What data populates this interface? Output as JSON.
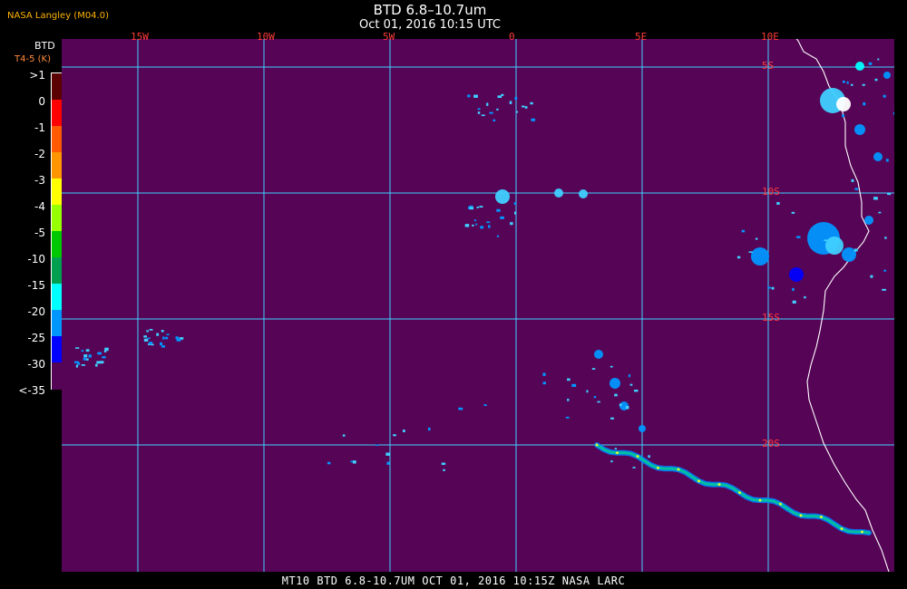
{
  "header": {
    "org": "NASA Langley (M04.0)",
    "title": "BTD 6.8–10.7um",
    "subtitle": "Oct 01, 2016 10:15 UTC"
  },
  "legend": {
    "title": "BTD",
    "subtitle": "T4-5 (K)",
    "labels": [
      ">1",
      "0",
      "-1",
      "-2",
      "-3",
      "-4",
      "-5",
      "-10",
      "-15",
      "-20",
      "-25",
      "-30",
      "<-35"
    ],
    "colors": [
      "#5a0000",
      "#ff0000",
      "#ff5a00",
      "#ff9600",
      "#ffff00",
      "#96ff00",
      "#00c800",
      "#00a050",
      "#00ffff",
      "#0096ff",
      "#0000ff",
      "#560456"
    ]
  },
  "map": {
    "background_color": "#560456",
    "grid_color": "#3fd0ff",
    "coast_color": "#ffffff",
    "longitude_labels": [
      "15W",
      "10W",
      "5W",
      "0",
      "5E",
      "10E"
    ],
    "latitude_labels": [
      "5S",
      "10S",
      "15S",
      "20S"
    ]
  },
  "footer": "MT10  BTD 6.8-10.7UM  OCT 01, 2016 10:15Z  NASA LARC"
}
